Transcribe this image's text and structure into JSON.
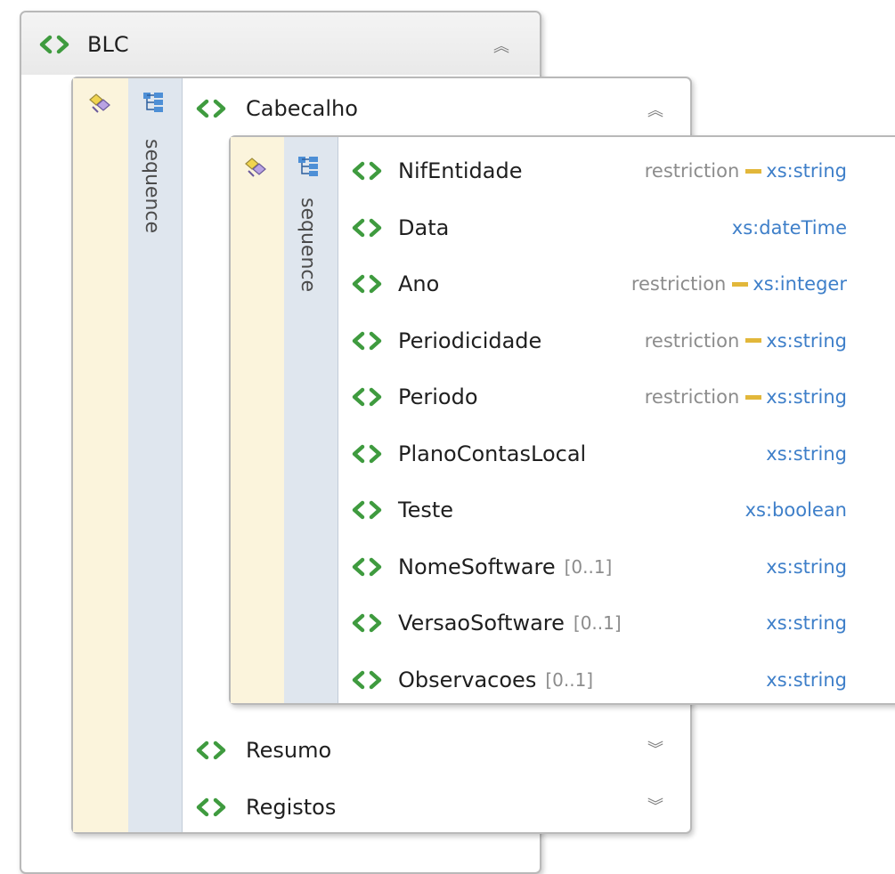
{
  "colors": {
    "element_icon": "#3f9b3f",
    "type_link": "#3e7fc9",
    "restriction_dash": "#e2b73a"
  },
  "blc": {
    "name": "BLC",
    "expand_state": "collapse"
  },
  "cabecalho": {
    "name": "Cabecalho",
    "compositor": "sequence",
    "expand_state": "collapse",
    "sequence": {
      "compositor": "sequence",
      "elements": [
        {
          "name": "NifEntidade",
          "occurrence": "",
          "restriction": "restriction",
          "type": "xs:string"
        },
        {
          "name": "Data",
          "occurrence": "",
          "restriction": "",
          "type": "xs:dateTime"
        },
        {
          "name": "Ano",
          "occurrence": "",
          "restriction": "restriction",
          "type": "xs:integer"
        },
        {
          "name": "Periodicidade",
          "occurrence": "",
          "restriction": "restriction",
          "type": "xs:string"
        },
        {
          "name": "Periodo",
          "occurrence": "",
          "restriction": "restriction",
          "type": "xs:string"
        },
        {
          "name": "PlanoContasLocal",
          "occurrence": "",
          "restriction": "",
          "type": "xs:string"
        },
        {
          "name": "Teste",
          "occurrence": "",
          "restriction": "",
          "type": "xs:boolean"
        },
        {
          "name": "NomeSoftware",
          "occurrence": "[0..1]",
          "restriction": "",
          "type": "xs:string"
        },
        {
          "name": "VersaoSoftware",
          "occurrence": "[0..1]",
          "restriction": "",
          "type": "xs:string"
        },
        {
          "name": "Observacoes",
          "occurrence": "[0..1]",
          "restriction": "",
          "type": "xs:string"
        }
      ]
    }
  },
  "siblings": [
    {
      "name": "Resumo",
      "expand_state": "expand"
    },
    {
      "name": "Registos",
      "expand_state": "expand"
    }
  ]
}
